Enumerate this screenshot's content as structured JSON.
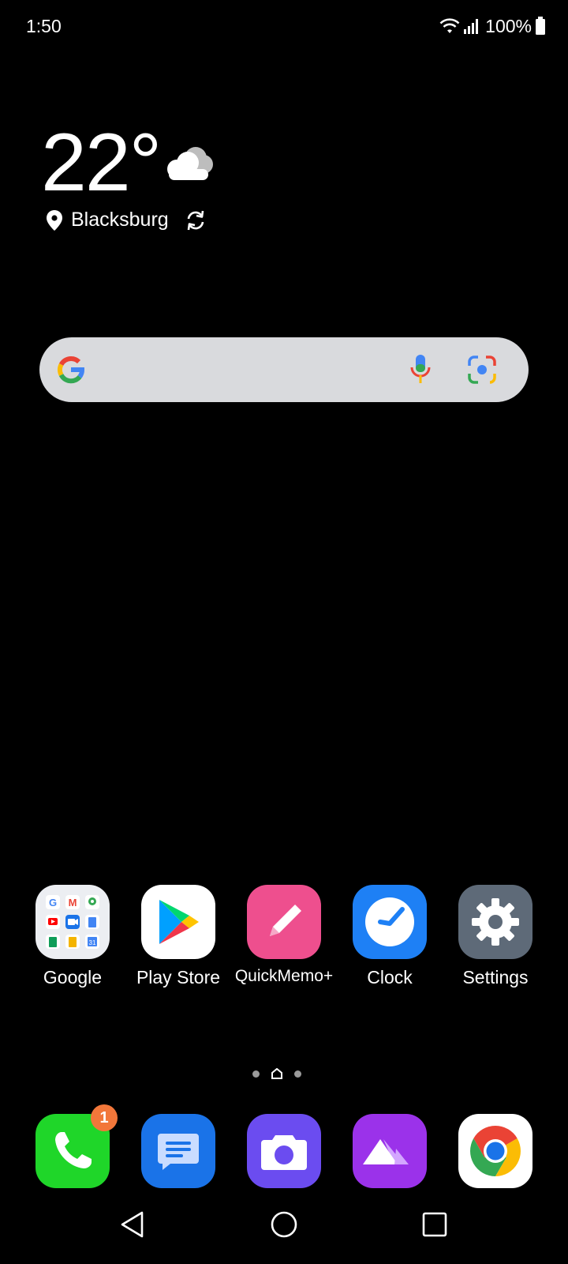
{
  "status_bar": {
    "time": "1:50",
    "battery_percent": "100%",
    "icons": [
      "wifi-icon",
      "signal-icon",
      "battery-icon"
    ]
  },
  "weather": {
    "temperature": "22°",
    "condition_icon": "cloud-icon",
    "location": "Blacksburg"
  },
  "search_bar": {
    "icons": [
      "google-logo-icon",
      "microphone-icon",
      "camera-lens-icon"
    ]
  },
  "apps": [
    {
      "label": "Google",
      "icon": "google-folder-icon"
    },
    {
      "label": "Play Store",
      "icon": "play-store-icon"
    },
    {
      "label": "QuickMemo+",
      "icon": "quickmemo-icon"
    },
    {
      "label": "Clock",
      "icon": "clock-icon"
    },
    {
      "label": "Settings",
      "icon": "settings-gear-icon"
    }
  ],
  "dock": [
    {
      "icon": "phone-icon",
      "badge": "1"
    },
    {
      "icon": "messages-icon"
    },
    {
      "icon": "camera-icon"
    },
    {
      "icon": "gallery-icon"
    },
    {
      "icon": "chrome-icon"
    }
  ],
  "page_indicator": {
    "pages": 3,
    "current": "home"
  },
  "nav_bar": [
    "back-icon",
    "home-icon",
    "recents-icon"
  ],
  "colors": {
    "background": "#000000",
    "phone_green": "#1fd629",
    "messages_blue": "#1a73e8",
    "camera_purple": "#6b4cf0",
    "gallery_purple": "#9b32ea",
    "quickmemo_pink": "#ee4f8e",
    "clock_blue": "#1e80f5",
    "settings_gray": "#5e6a78",
    "badge_orange": "#f2773a"
  }
}
